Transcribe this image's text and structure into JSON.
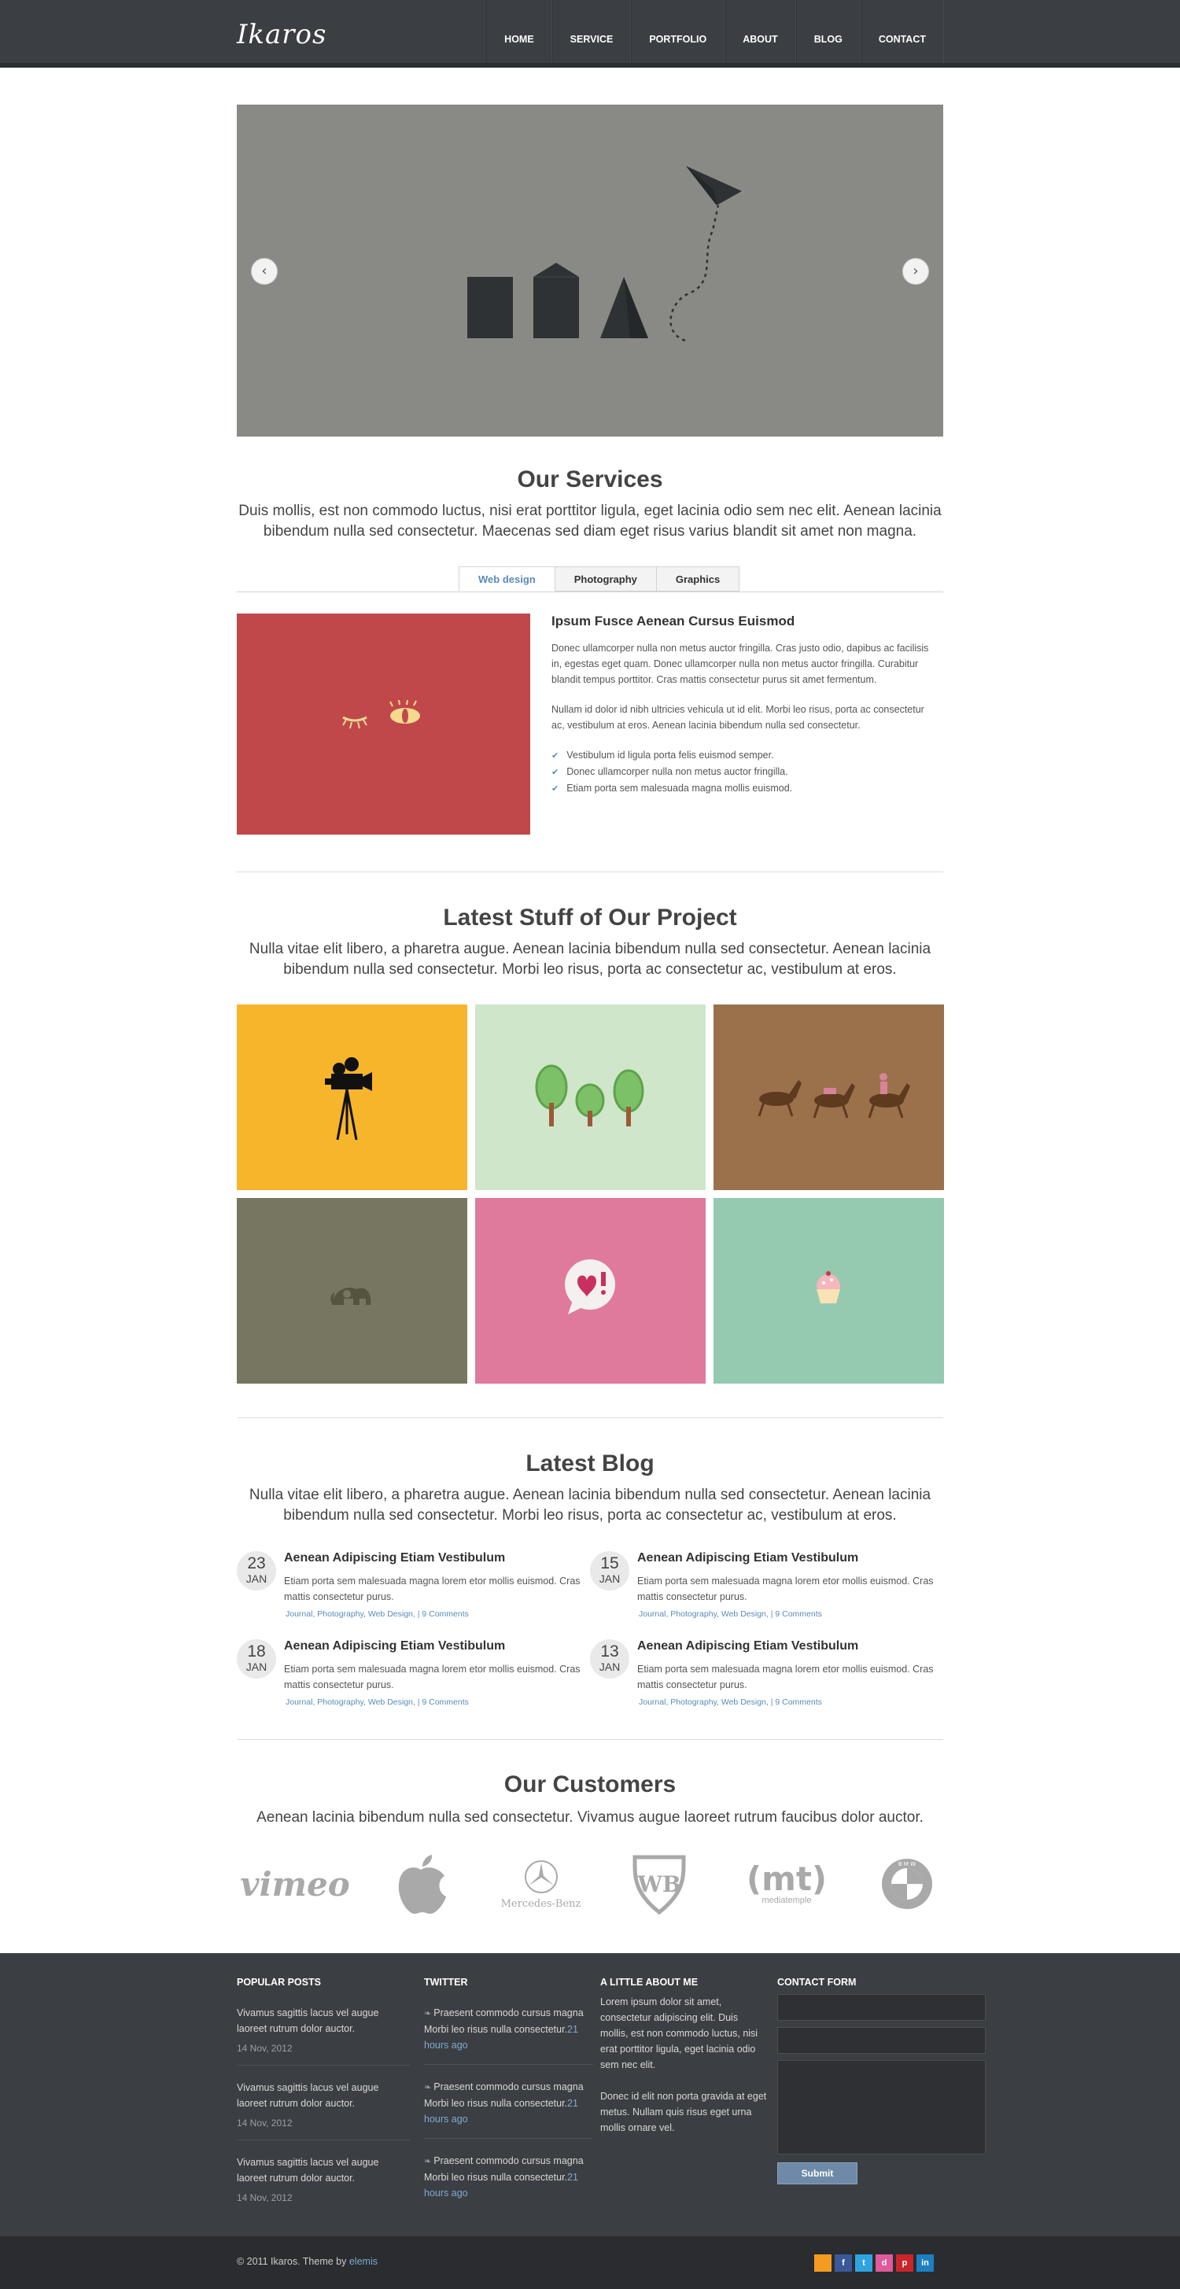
{
  "header": {
    "logo": "Ikaros",
    "nav": [
      "HOME",
      "SERVICE",
      "PORTFOLIO",
      "ABOUT",
      "BLOG",
      "CONTACT"
    ]
  },
  "slider": {
    "prev": "‹",
    "next": "›"
  },
  "services": {
    "title": "Our Services",
    "subtitle": "Duis mollis, est non commodo luctus, nisi erat porttitor ligula, eget lacinia odio sem nec elit. Aenean lacinia bibendum nulla sed consectetur. Maecenas sed diam eget risus varius blandit sit amet non magna.",
    "tabs": [
      "Web design",
      "Photography",
      "Graphics"
    ],
    "heading": "Ipsum Fusce Aenean Cursus Euismod",
    "p1": "Donec ullamcorper nulla non metus auctor fringilla. Cras justo odio, dapibus ac facilisis in, egestas eget quam. Donec ullamcorper nulla non metus auctor fringilla. Curabitur blandit tempus porttitor. Cras mattis consectetur purus sit amet fermentum.",
    "p2": "Nullam id dolor id nibh ultricies vehicula ut id elit. Morbi leo risus, porta ac consectetur ac, vestibulum at eros. Aenean lacinia bibendum nulla sed consectetur.",
    "list": [
      "Vestibulum id ligula porta felis euismod semper.",
      "Donec ullamcorper nulla non metus auctor fringilla.",
      "Etiam porta sem malesuada magna mollis euismod."
    ]
  },
  "projects": {
    "title": "Latest Stuff of Our Project",
    "subtitle": "Nulla vitae elit libero, a pharetra augue. Aenean lacinia bibendum nulla sed consectetur. Aenean lacinia bibendum nulla sed consectetur. Morbi leo risus, porta ac consectetur ac, vestibulum at eros.",
    "colors": [
      "#f7b52c",
      "#cfe6cb",
      "#9b714b",
      "#777660",
      "#df7a9c",
      "#95cab0"
    ]
  },
  "blog": {
    "title": "Latest Blog",
    "subtitle": "Nulla vitae elit libero, a pharetra augue. Aenean lacinia bibendum nulla sed consectetur. Aenean lacinia bibendum nulla sed consectetur. Morbi leo risus, porta ac consectetur ac, vestibulum at eros.",
    "posts": [
      {
        "day": "23",
        "month": "JAN",
        "title": "Aenean Adipiscing Etiam Vestibulum",
        "text": "Etiam porta sem malesuada magna lorem etor mollis euismod. Cras mattis consectetur purus.",
        "meta": "Journal, Photography, Web Design, | 9 Comments"
      },
      {
        "day": "15",
        "month": "JAN",
        "title": "Aenean Adipiscing Etiam Vestibulum",
        "text": "Etiam porta sem malesuada magna lorem etor mollis euismod. Cras mattis consectetur purus.",
        "meta": "Journal, Photography, Web Design, | 9 Comments"
      },
      {
        "day": "18",
        "month": "JAN",
        "title": "Aenean Adipiscing Etiam Vestibulum",
        "text": "Etiam porta sem malesuada magna lorem etor mollis euismod. Cras mattis consectetur purus.",
        "meta": "Journal, Photography, Web Design, | 9 Comments"
      },
      {
        "day": "13",
        "month": "JAN",
        "title": "Aenean Adipiscing Etiam Vestibulum",
        "text": "Etiam porta sem malesuada magna lorem etor mollis euismod. Cras mattis consectetur purus.",
        "meta": "Journal, Photography, Web Design, | 9 Comments"
      }
    ]
  },
  "customers": {
    "title": "Our Customers",
    "subtitle": "Aenean lacinia bibendum nulla sed consectetur. Vivamus augue laoreet rutrum faucibus dolor auctor.",
    "logos": [
      "vimeo",
      "Mercedes-Benz",
      "(mt)",
      "mediatemple",
      "B M W"
    ]
  },
  "footer": {
    "popular_title": "POPULAR POSTS",
    "popular": [
      {
        "text": "Vivamus sagittis lacus vel augue laoreet rutrum dolor auctor.",
        "date": "14 Nov, 2012"
      },
      {
        "text": "Vivamus sagittis lacus vel augue laoreet rutrum dolor auctor.",
        "date": "14 Nov, 2012"
      },
      {
        "text": "Vivamus sagittis lacus vel augue laoreet rutrum dolor auctor.",
        "date": "14 Nov, 2012"
      }
    ],
    "twitter_title": "TWITTER",
    "tweets": [
      {
        "text": "Praesent commodo cursus magna Morbi leo risus nulla consectetur.",
        "time": "21 hours ago"
      },
      {
        "text": "Praesent commodo cursus magna Morbi leo risus nulla consectetur.",
        "time": "21 hours ago"
      },
      {
        "text": "Praesent commodo cursus magna Morbi leo risus nulla consectetur.",
        "time": "21 hours ago"
      }
    ],
    "about_title": "A LITTLE ABOUT ME",
    "about_p1": "Lorem ipsum dolor sit amet, consectetur adipiscing elit. Duis mollis, est non commodo luctus, nisi erat porttitor ligula, eget lacinia odio sem nec elit.",
    "about_p2": "Donec id elit non porta gravida at eget metus. Nullam quis risus eget urna mollis ornare vel.",
    "contact_title": "CONTACT FORM",
    "submit": "Submit"
  },
  "bottom": {
    "copyright": "© 2011 Ikaros. Theme by ",
    "theme_link": "elemis",
    "social": [
      {
        "name": "rss",
        "label": "",
        "color": "#f39c21"
      },
      {
        "name": "facebook",
        "label": "f",
        "color": "#3b5998"
      },
      {
        "name": "twitter",
        "label": "t",
        "color": "#2fa3e0"
      },
      {
        "name": "dribbble",
        "label": "d",
        "color": "#e05a9c"
      },
      {
        "name": "pinterest",
        "label": "p",
        "color": "#c9252b"
      },
      {
        "name": "linkedin",
        "label": "in",
        "color": "#1d7fc2"
      }
    ]
  }
}
